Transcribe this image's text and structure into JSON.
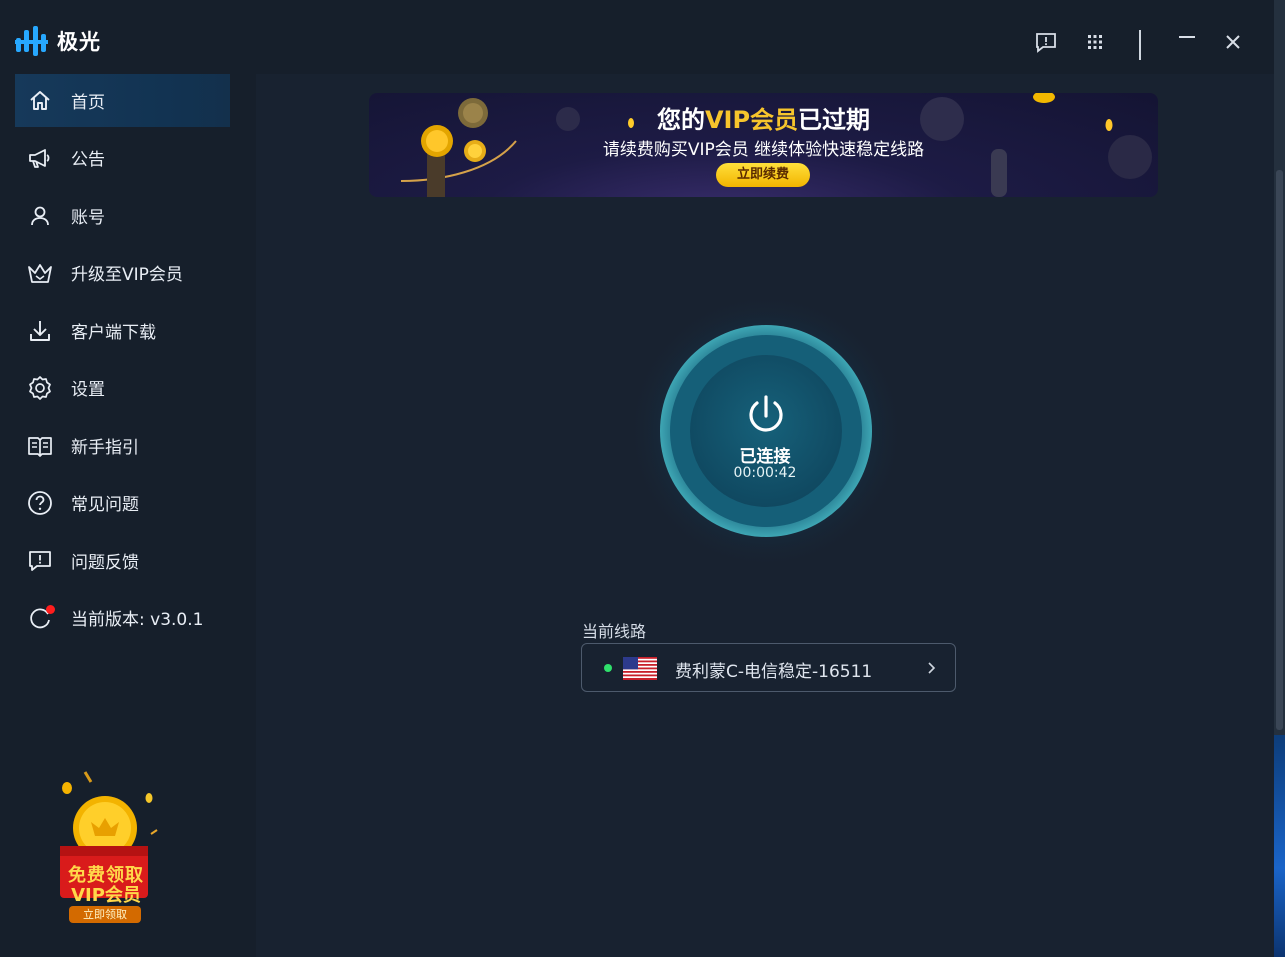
{
  "app": {
    "title": "极光"
  },
  "sidebar": {
    "items": [
      {
        "label": "首页",
        "icon": "home-icon"
      },
      {
        "label": "公告",
        "icon": "megaphone-icon"
      },
      {
        "label": "账号",
        "icon": "user-icon"
      },
      {
        "label": "升级至VIP会员",
        "icon": "crown-icon"
      },
      {
        "label": "客户端下载",
        "icon": "download-icon"
      },
      {
        "label": "设置",
        "icon": "gear-icon"
      },
      {
        "label": "新手指引",
        "icon": "book-icon"
      },
      {
        "label": "常见问题",
        "icon": "question-icon"
      },
      {
        "label": "问题反馈",
        "icon": "feedback-icon"
      },
      {
        "label": "当前版本: v3.0.1",
        "icon": "refresh-icon"
      }
    ],
    "promo": {
      "line1": "免费领取",
      "line2": "VIP会员",
      "button": "立即领取"
    }
  },
  "banner": {
    "title_prefix": "您的",
    "title_vip": "VIP会员",
    "title_suffix": "已过期",
    "subtitle": "请续费购买VIP会员 继续体验快速稳定线路",
    "button": "立即续费"
  },
  "connection": {
    "status": "已连接",
    "elapsed": "00:00:42"
  },
  "route": {
    "label": "当前线路",
    "name": "费利蒙C-电信稳定-16511",
    "status_color": "#2fe06b"
  },
  "colors": {
    "accent": "#f7c52c",
    "active_nav": "#16395a",
    "ring": "#2a8fa0"
  }
}
